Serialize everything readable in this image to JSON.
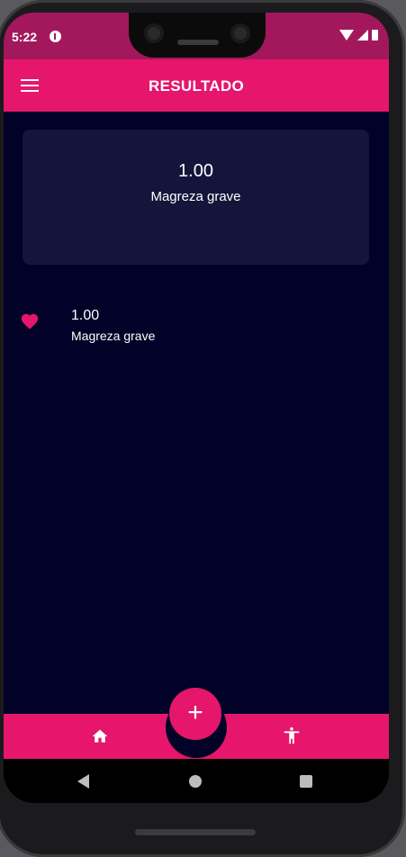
{
  "status_bar": {
    "time": "5:22",
    "icons": [
      "app-notification-icon",
      "wifi-icon",
      "cell-signal-icon",
      "battery-icon"
    ]
  },
  "app_bar": {
    "title": "RESULTADO",
    "menu_icon": "hamburger-menu-icon"
  },
  "result_card": {
    "value": "1.00",
    "label": "Magreza grave"
  },
  "history": [
    {
      "icon": "heart-icon",
      "value": "1.00",
      "label": "Magreza grave"
    }
  ],
  "bottom_bar": {
    "fab_icon": "plus-icon",
    "fab_symbol": "+",
    "left_icon": "home-icon",
    "right_icon": "accessibility-person-icon"
  },
  "system_nav": [
    "back-icon",
    "home-circle-icon",
    "recents-icon"
  ],
  "colors": {
    "status_bar": "#a3185c",
    "accent": "#e5166c",
    "background": "#020229",
    "card": "#13163a",
    "text": "#ffffff"
  }
}
